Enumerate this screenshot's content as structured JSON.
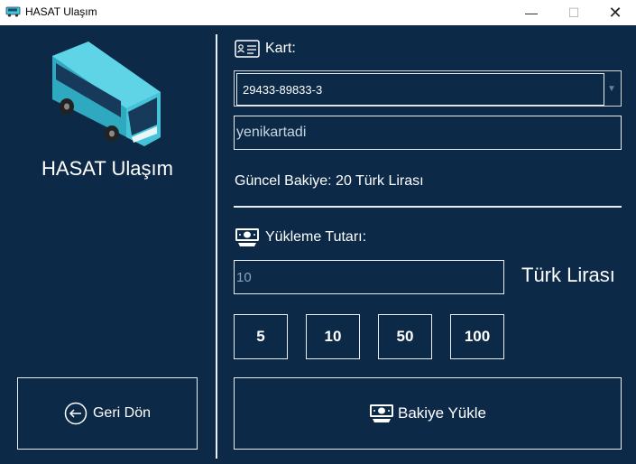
{
  "window": {
    "title": "HASAT Ulaşım",
    "minimize_glyph": "—",
    "maximize_glyph": "☐",
    "close_glyph": "✕"
  },
  "brand": {
    "name": "HASAT Ulaşım",
    "logo_icon": "bus-icon",
    "bus_color": "#45c4d8"
  },
  "back_button": {
    "label": "Geri Dön",
    "icon": "arrow-left-circle-icon"
  },
  "card": {
    "label": "Kart:",
    "icon": "id-card-icon",
    "selected": "29433-89833-3",
    "name_value": "yenikartadi"
  },
  "balance_text": "Güncel Bakiye: 20 Türk Lirası",
  "amount": {
    "label": "Yükleme Tutarı:",
    "icon": "banknote-icon",
    "value": "10",
    "currency": "Türk Lirası"
  },
  "quick_amounts": [
    "5",
    "10",
    "50",
    "100"
  ],
  "load_button": {
    "label": "Bakiye Yükle",
    "icon": "banknote-icon"
  },
  "colors": {
    "background": "#0c2a48",
    "foreground": "#ffffff"
  }
}
